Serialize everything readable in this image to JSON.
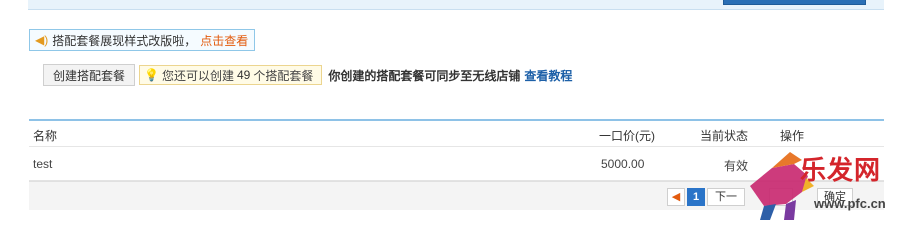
{
  "notice": {
    "text": "搭配套餐展现样式改版啦，",
    "link": "点击查看"
  },
  "actions": {
    "create_button": "创建搭配套餐",
    "tip_prefix": "您还可以创建",
    "tip_count": "49",
    "tip_suffix": "个搭配套餐",
    "sync_text": "你创建的搭配套餐可同步至无线店铺",
    "tutorial_link": "查看教程"
  },
  "table": {
    "headers": {
      "name": "名称",
      "price": "一口价(元)",
      "status": "当前状态",
      "ops": "操作"
    },
    "rows": [
      {
        "name": "test",
        "price": "5000.00",
        "status": "有效"
      }
    ]
  },
  "pager": {
    "prev": "◀",
    "current": "1",
    "next": "下一",
    "go": "确定"
  },
  "watermark": {
    "text": "乐发网",
    "url": "www.pfc.cn"
  },
  "colors": {
    "accent": "#2a74c8",
    "link_orange": "#e35b0e",
    "header_border": "#8ec2e7"
  }
}
